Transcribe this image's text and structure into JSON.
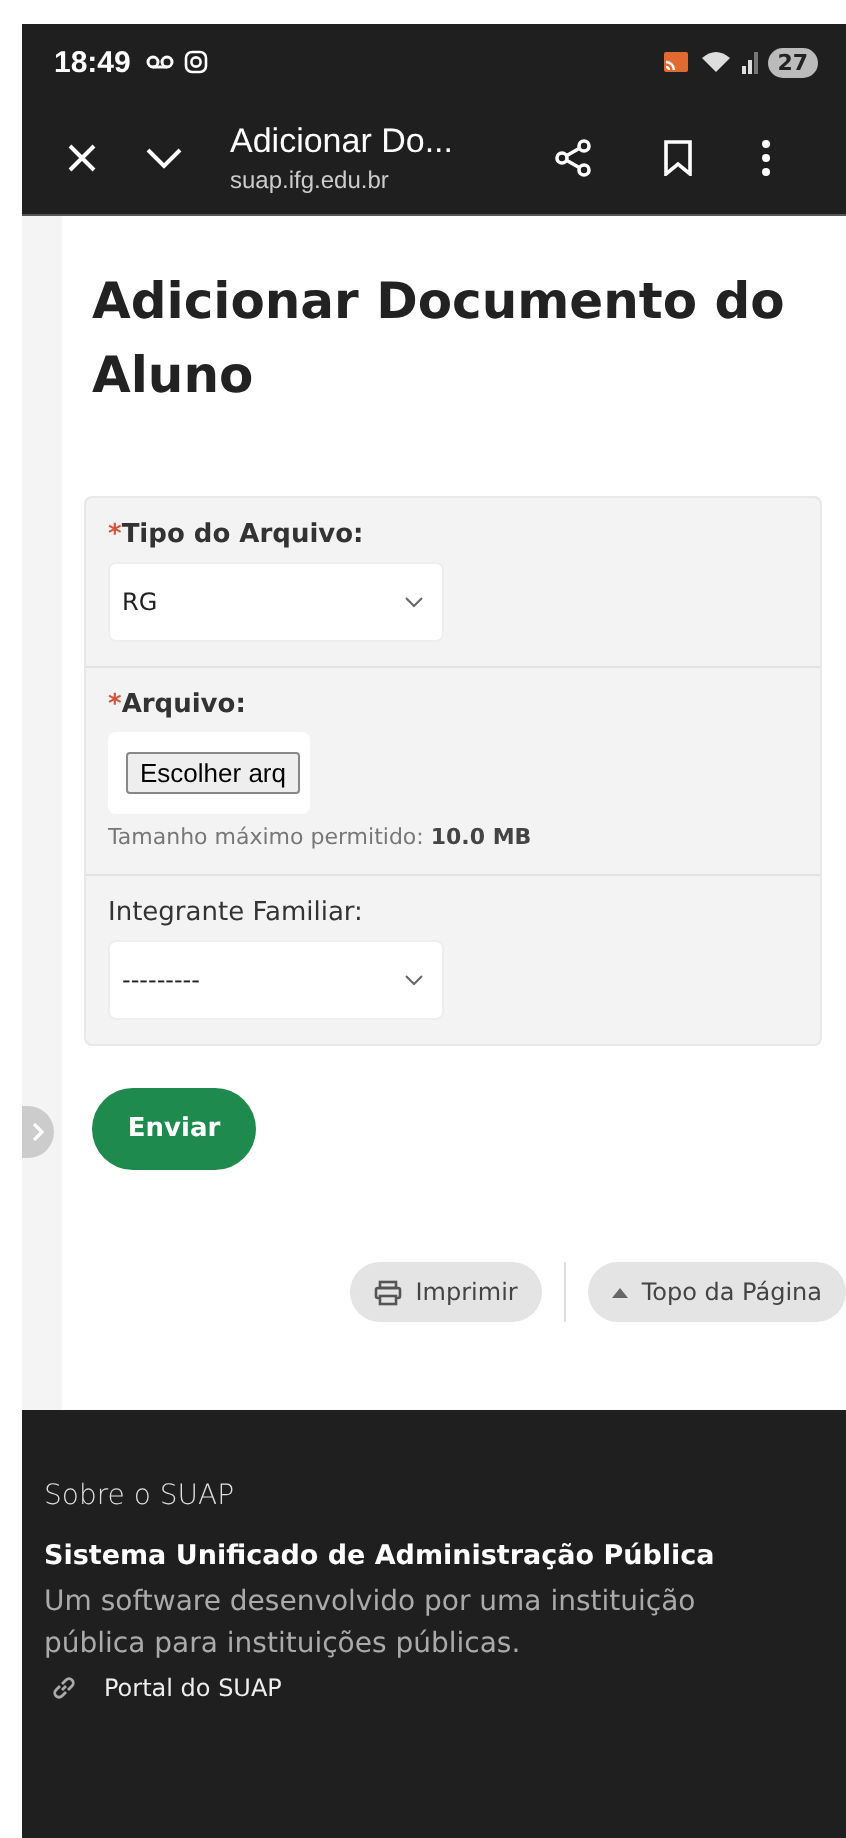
{
  "status_bar": {
    "time": "18:49",
    "battery": "27"
  },
  "browser_toolbar": {
    "title": "Adicionar Do...",
    "url": "suap.ifg.edu.br"
  },
  "page_title": "Adicionar Documento do Aluno",
  "form": {
    "fields": [
      {
        "kind": "select",
        "label": "Tipo do Arquivo:",
        "required": true,
        "value": "RG"
      },
      {
        "kind": "file",
        "label": "Arquivo:",
        "required": true,
        "button": "Escolher arq",
        "help": "Tamanho máximo permitido: **10.0 MB**"
      },
      {
        "kind": "select",
        "label": "Integrante Familiar:",
        "required": false,
        "value": "---------"
      }
    ],
    "required_marker": "*",
    "submit": "Enviar"
  },
  "page_actions": [
    {
      "kind": "print",
      "label": "Imprimir"
    },
    {
      "kind": "top",
      "label": "Topo da Página"
    }
  ],
  "footer": {
    "heading": "Sobre o SUAP",
    "title": "Sistema Unificado de Administração Pública",
    "description": "Um software desenvolvido por uma instituição pública para instituições públicas.",
    "link": "Portal do SUAP"
  }
}
